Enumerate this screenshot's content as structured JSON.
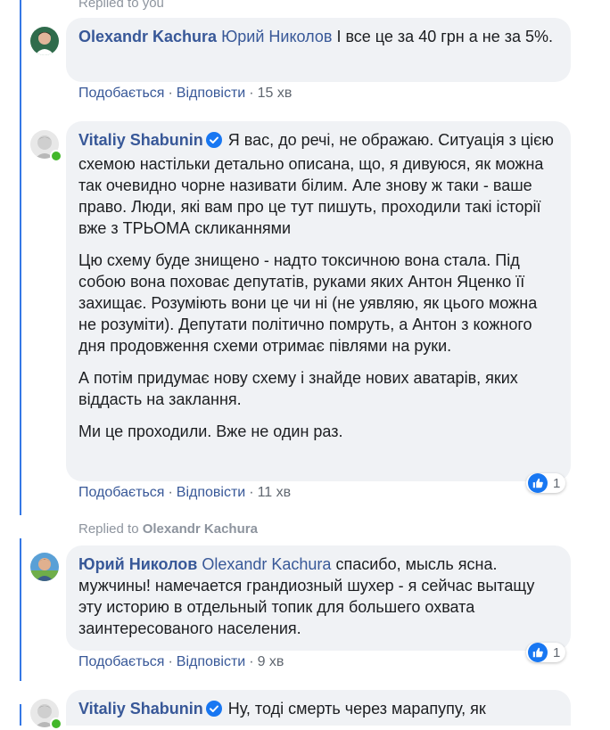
{
  "top_replied": "Replied to you",
  "comments": [
    {
      "author": "Olexandr Kachura",
      "mention": "Юрий Николов",
      "text": "І все це за 40 грн а не за 5%.",
      "like_label": "Подобається",
      "reply_label": "Відповісти",
      "time": "15 хв"
    },
    {
      "author": "Vitaliy Shabunin",
      "paragraphs": [
        "Я вас, до речі, не ображаю. Ситуація з цією схемою настільки детально описана, що, я дивуюся, як можна так очевидно чорне називати білим. Але знову ж таки - ваше право. Люди, які вам про це тут пишуть, проходили такі історії вже з ТРЬОМА скликаннями",
        "Цю схему буде знищено - надто токсичною вона стала. Під собою вона поховає депутатів, руками яких Антон Яценко її захищає. Розуміють вони це чи ні (не уявляю, як цього можна не розуміти). Депутати політично помруть, а Антон з кожного дня продовження схеми отримає півлями на руки.",
        "А потім придумає нову схему і знайде нових аватарів, яких віддасть на заклання.",
        "Ми це проходили. Вже не один раз."
      ],
      "like_label": "Подобається",
      "reply_label": "Відповісти",
      "time": "11 хв",
      "reaction_count": "1"
    },
    {
      "replied_prefix": "Replied to",
      "replied_name": "Olexandr Kachura",
      "author": "Юрий Николов",
      "mention": "Olexandr Kachura",
      "text": "спасибо, мысль ясна. мужчины! намечается грандиозный шухер - я сейчас вытащу эту историю в отдельный топик для большего охвата заинтересованого населения.",
      "like_label": "Подобається",
      "reply_label": "Відповісти",
      "time": "9 хв",
      "reaction_count": "1"
    },
    {
      "author": "Vitaliy Shabunin",
      "text": "Ну, тоді смерть через марапупу, як"
    }
  ],
  "colors": {
    "link": "#385898",
    "bubble": "#f0f2f5",
    "thread": "#3578e5",
    "like": "#1877f2",
    "online": "#42b72a"
  },
  "icons": [
    "verified-badge-icon",
    "like-reaction-icon",
    "online-status-icon"
  ]
}
